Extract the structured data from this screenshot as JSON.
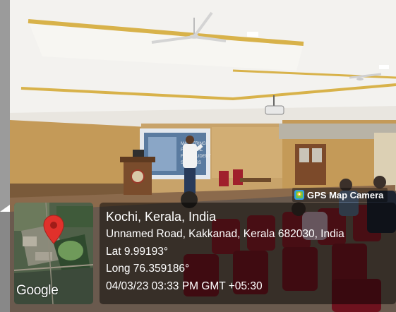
{
  "badge": {
    "label": "GPS Map Camera",
    "icon": "gps-map-camera-app-icon"
  },
  "location": {
    "title": "Kochi, Kerala, India",
    "address": "Unnamed Road, Kakkanad, Kerala 682030, India",
    "lat": "Lat 9.99193°",
    "long": "Long 76.359186°",
    "timestamp": "04/03/23 03:33 PM GMT +05:30"
  },
  "map": {
    "provider_logo": "Google",
    "marker": "map-pin-icon",
    "pin_color": "#e0312b"
  },
  "colors": {
    "ceiling": "#f2f1ee",
    "gold_trim": "#d8b24a",
    "wall": "#c49a58",
    "curtain": "#dcd0b4",
    "chairs": "#8a1c28"
  }
}
